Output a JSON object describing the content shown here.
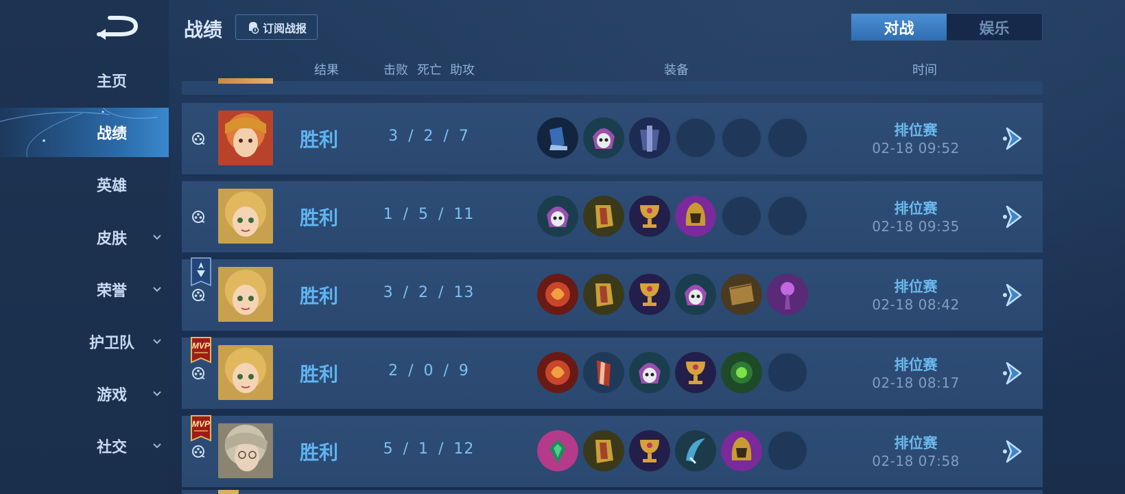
{
  "sidebar": {
    "items": [
      {
        "label": "主页",
        "has_sub": false,
        "active": false
      },
      {
        "label": "战绩",
        "has_sub": false,
        "active": true
      },
      {
        "label": "英雄",
        "has_sub": false,
        "active": false
      },
      {
        "label": "皮肤",
        "has_sub": true,
        "active": false
      },
      {
        "label": "荣誉",
        "has_sub": true,
        "active": false
      },
      {
        "label": "护卫队",
        "has_sub": true,
        "active": false
      },
      {
        "label": "游戏",
        "has_sub": true,
        "active": false
      },
      {
        "label": "社交",
        "has_sub": true,
        "active": false
      }
    ]
  },
  "header": {
    "title": "战绩",
    "subscribe_label": "订阅战报",
    "tabs": [
      {
        "label": "对战",
        "active": true
      },
      {
        "label": "娱乐",
        "active": false
      }
    ]
  },
  "columns": {
    "result": "结果",
    "kills": "击败",
    "deaths": "死亡",
    "assists": "助攻",
    "equipment": "装备",
    "time": "时间"
  },
  "matches": [
    {
      "hero_icon": "hero-portrait-red-hair",
      "badge": null,
      "result": "胜利",
      "kda": "3 / 2 / 7",
      "items": [
        "boots-icon",
        "skull-helm-icon",
        "dark-armor-icon",
        "empty",
        "empty",
        "empty"
      ],
      "mode": "排位赛",
      "time": "02-18  09:52"
    },
    {
      "hero_icon": "hero-portrait-blonde-girl",
      "badge": null,
      "result": "胜利",
      "kda": "1 / 5 / 11",
      "items": [
        "skull-helm-icon",
        "gold-gauntlet-icon",
        "chalice-icon",
        "purple-helm-icon",
        "empty",
        "empty"
      ],
      "mode": "排位赛",
      "time": "02-18  09:35"
    },
    {
      "hero_icon": "hero-portrait-blonde-girl",
      "badge": "banner",
      "result": "胜利",
      "kda": "3 / 2 / 13",
      "items": [
        "flame-orb-icon",
        "gold-gauntlet-icon",
        "chalice-icon",
        "skull-helm-icon",
        "book-icon",
        "purple-staff-icon"
      ],
      "mode": "排位赛",
      "time": "02-18  08:42"
    },
    {
      "hero_icon": "hero-portrait-blonde-girl",
      "badge": "mvp",
      "result": "胜利",
      "kda": "2 / 0 / 9",
      "items": [
        "flame-orb-icon",
        "red-scroll-icon",
        "skull-helm-icon",
        "chalice-icon",
        "green-gem-icon",
        "empty"
      ],
      "mode": "排位赛",
      "time": "02-18  08:17"
    },
    {
      "hero_icon": "hero-portrait-silver-hair",
      "badge": "mvp",
      "result": "胜利",
      "kda": "5 / 1 / 12",
      "items": [
        "emerald-icon",
        "gold-gauntlet-icon",
        "chalice-icon",
        "blue-blade-icon",
        "purple-helm-icon",
        "empty"
      ],
      "mode": "排位赛",
      "time": "02-18  07:58"
    }
  ],
  "badges": {
    "mvp": "MVP"
  },
  "colors": {
    "win_text": "#5fb4f0",
    "row_bg": "#2e4d76",
    "active_tab": "#3d80c4"
  }
}
